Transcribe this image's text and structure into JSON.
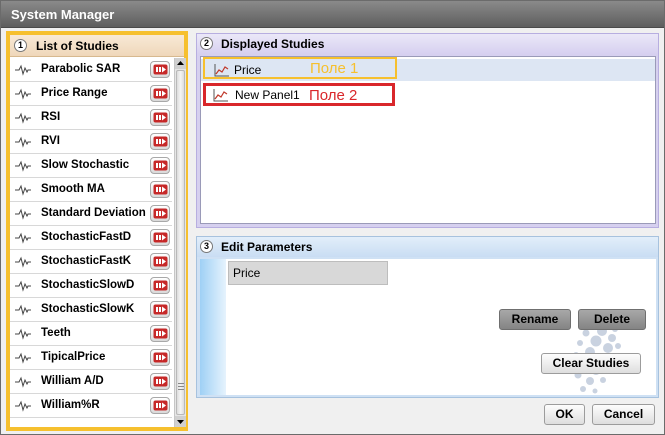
{
  "window": {
    "title": "System Manager"
  },
  "studies_panel": {
    "number": "1",
    "title": "List of Studies",
    "items": [
      {
        "label": "Parabolic SAR"
      },
      {
        "label": "Price Range"
      },
      {
        "label": "RSI"
      },
      {
        "label": "RVI"
      },
      {
        "label": "Slow Stochastic"
      },
      {
        "label": "Smooth MA"
      },
      {
        "label": "Standard Deviation"
      },
      {
        "label": "StochasticFastD"
      },
      {
        "label": "StochasticFastK"
      },
      {
        "label": "StochasticSlowD"
      },
      {
        "label": "StochasticSlowK"
      },
      {
        "label": "Teeth"
      },
      {
        "label": "TipicalPrice"
      },
      {
        "label": "William A/D"
      },
      {
        "label": "William%R"
      }
    ]
  },
  "displayed_panel": {
    "number": "2",
    "title": "Displayed Studies",
    "rows": [
      {
        "label": "Price",
        "annotation": "Поле 1"
      },
      {
        "label": "New Panel1",
        "annotation": "Поле 2"
      }
    ]
  },
  "edit_panel": {
    "number": "3",
    "title": "Edit Parameters",
    "name_value": "Price",
    "rename_label": "Rename",
    "delete_label": "Delete",
    "clear_label": "Clear Studies"
  },
  "footer": {
    "ok_label": "OK",
    "cancel_label": "Cancel"
  },
  "colors": {
    "highlight_yellow": "#f6c02e",
    "highlight_red": "#d9272b",
    "title_bar": "#6e6e6e"
  }
}
